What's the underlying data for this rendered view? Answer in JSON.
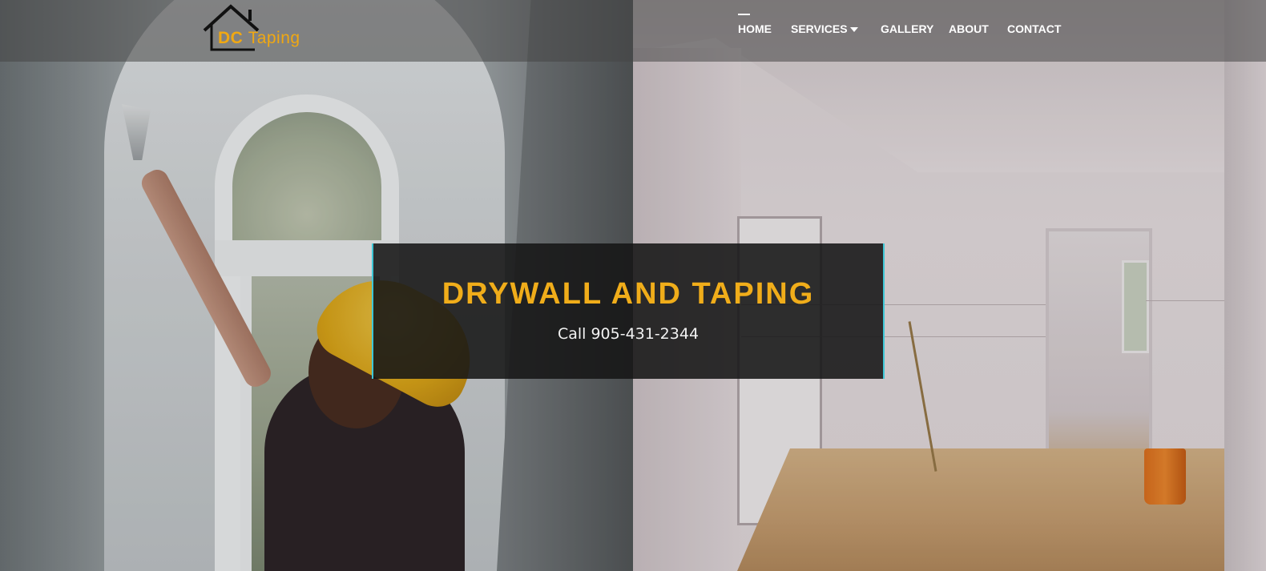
{
  "site": {
    "logo": {
      "name_part1": "DC",
      "name_part2": "Taping",
      "accent_color": "#f0a812",
      "icon": "house-roof-icon"
    }
  },
  "nav": {
    "items": [
      {
        "label": "HOME",
        "active": true
      },
      {
        "label": "SERVICES",
        "has_dropdown": true
      },
      {
        "label": "GALLERY"
      },
      {
        "label": "ABOUT"
      },
      {
        "label": "CONTACT"
      }
    ],
    "dropdown_icon": "caret-down-icon"
  },
  "hero": {
    "title": "DRYWALL AND TAPING",
    "subtitle": "Call 905-431-2344",
    "title_color": "#f0ad1a",
    "border_color": "#3ec7d6"
  }
}
